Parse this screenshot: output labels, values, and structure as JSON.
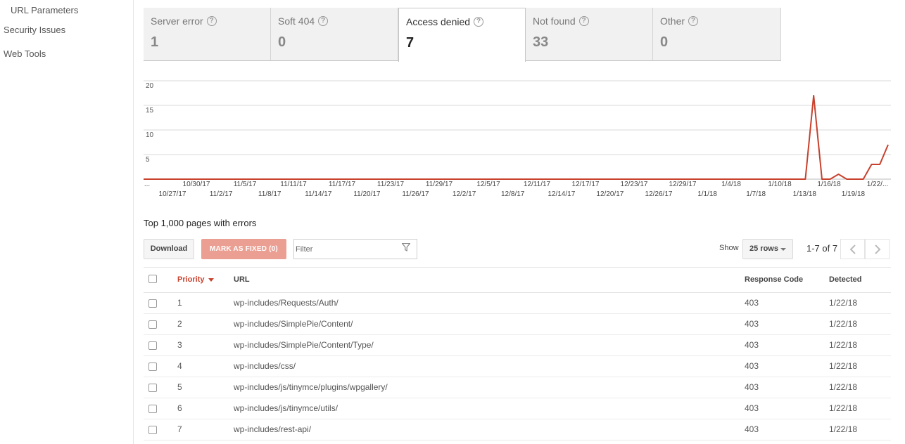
{
  "sidebar": {
    "items": [
      {
        "label": "URL Parameters"
      },
      {
        "label": "Security Issues"
      },
      {
        "label": "Web Tools"
      }
    ]
  },
  "tabs": [
    {
      "label": "Server error",
      "count": "1",
      "active": false
    },
    {
      "label": "Soft 404",
      "count": "0",
      "active": false
    },
    {
      "label": "Access denied",
      "count": "7",
      "active": true
    },
    {
      "label": "Not found",
      "count": "33",
      "active": false
    },
    {
      "label": "Other",
      "count": "0",
      "active": false
    }
  ],
  "help_glyph": "?",
  "chart_data": {
    "type": "line",
    "title": "",
    "xlabel": "",
    "ylabel": "",
    "ylim": [
      0,
      20
    ],
    "yticks": [
      "20",
      "15",
      "10",
      "5"
    ],
    "grid": true,
    "series_color": "#c8412d",
    "xticks_top": [
      "...",
      "10/30/17",
      "11/5/17",
      "11/11/17",
      "11/17/17",
      "11/23/17",
      "11/29/17",
      "12/5/17",
      "12/11/17",
      "12/17/17",
      "12/23/17",
      "12/29/17",
      "1/4/18",
      "1/10/18",
      "1/16/18",
      "1/22/..."
    ],
    "xticks_bottom": [
      "10/27/17",
      "11/2/17",
      "11/8/17",
      "11/14/17",
      "11/20/17",
      "11/26/17",
      "12/2/17",
      "12/8/17",
      "12/14/17",
      "12/20/17",
      "12/26/17",
      "1/1/18",
      "1/7/18",
      "1/13/18",
      "1/19/18"
    ],
    "series": [
      {
        "values": [
          0,
          0,
          0,
          0,
          0,
          0,
          0,
          0,
          0,
          0,
          0,
          0,
          0,
          0,
          0,
          0,
          0,
          0,
          0,
          0,
          0,
          0,
          0,
          0,
          0,
          0,
          0,
          0,
          0,
          0,
          0,
          0,
          0,
          0,
          0,
          0,
          0,
          0,
          0,
          0,
          0,
          0,
          0,
          0,
          0,
          0,
          0,
          0,
          0,
          0,
          0,
          0,
          0,
          0,
          0,
          0,
          0,
          0,
          0,
          0,
          0,
          0,
          0,
          0,
          0,
          0,
          0,
          0,
          0,
          0,
          0,
          0,
          0,
          0,
          0,
          0,
          0,
          0,
          0,
          0,
          0,
          17,
          0,
          0,
          1,
          0,
          0,
          0,
          3,
          3,
          7
        ]
      }
    ]
  },
  "section_title": "Top 1,000 pages with errors",
  "toolbar": {
    "download_label": "Download",
    "mark_fixed_label": "MARK AS FIXED (0)",
    "filter_placeholder": "Filter",
    "show_label": "Show",
    "rows_value": "25 rows",
    "page_range": "1-7 of 7"
  },
  "table": {
    "headers": {
      "priority": "Priority",
      "url": "URL",
      "response_code": "Response Code",
      "detected": "Detected"
    },
    "rows": [
      {
        "priority": "1",
        "url": "wp-includes/Requests/Auth/",
        "code": "403",
        "detected": "1/22/18"
      },
      {
        "priority": "2",
        "url": "wp-includes/SimplePie/Content/",
        "code": "403",
        "detected": "1/22/18"
      },
      {
        "priority": "3",
        "url": "wp-includes/SimplePie/Content/Type/",
        "code": "403",
        "detected": "1/22/18"
      },
      {
        "priority": "4",
        "url": "wp-includes/css/",
        "code": "403",
        "detected": "1/22/18"
      },
      {
        "priority": "5",
        "url": "wp-includes/js/tinymce/plugins/wpgallery/",
        "code": "403",
        "detected": "1/22/18"
      },
      {
        "priority": "6",
        "url": "wp-includes/js/tinymce/utils/",
        "code": "403",
        "detected": "1/22/18"
      },
      {
        "priority": "7",
        "url": "wp-includes/rest-api/",
        "code": "403",
        "detected": "1/22/18"
      }
    ]
  }
}
